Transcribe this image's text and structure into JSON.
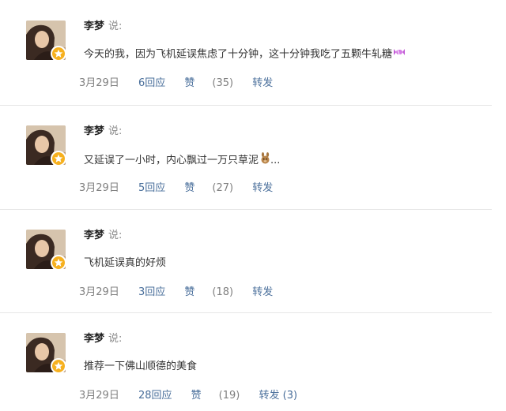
{
  "posts": [
    {
      "author": "李梦",
      "said": "说:",
      "text": "今天的我，因为飞机延误焦虑了十分钟，这十分钟我吃了五颗牛轧糖",
      "emoji": "candy-icon",
      "date": "3月29日",
      "reply": "6回应",
      "like": "赞",
      "like_count": "(35)",
      "repost": "转发"
    },
    {
      "author": "李梦",
      "said": "说:",
      "text": "又延误了一小时，内心飘过一万只草泥",
      "emoji": "alpaca-icon",
      "text_suffix": "...",
      "date": "3月29日",
      "reply": "5回应",
      "like": "赞",
      "like_count": "(27)",
      "repost": "转发"
    },
    {
      "author": "李梦",
      "said": "说:",
      "text": "飞机延误真的好烦",
      "date": "3月29日",
      "reply": "3回应",
      "like": "赞",
      "like_count": "(18)",
      "repost": "转发"
    },
    {
      "author": "李梦",
      "said": "说:",
      "text": "推荐一下佛山顺德的美食",
      "date": "3月29日",
      "reply": "28回应",
      "like": "赞",
      "like_count": "(19)",
      "repost": "转发 (3)"
    }
  ],
  "colors": {
    "link": "#4a6f9b",
    "muted": "#808080",
    "badge": "#f6b01e",
    "divider": "#e6e6e6"
  }
}
